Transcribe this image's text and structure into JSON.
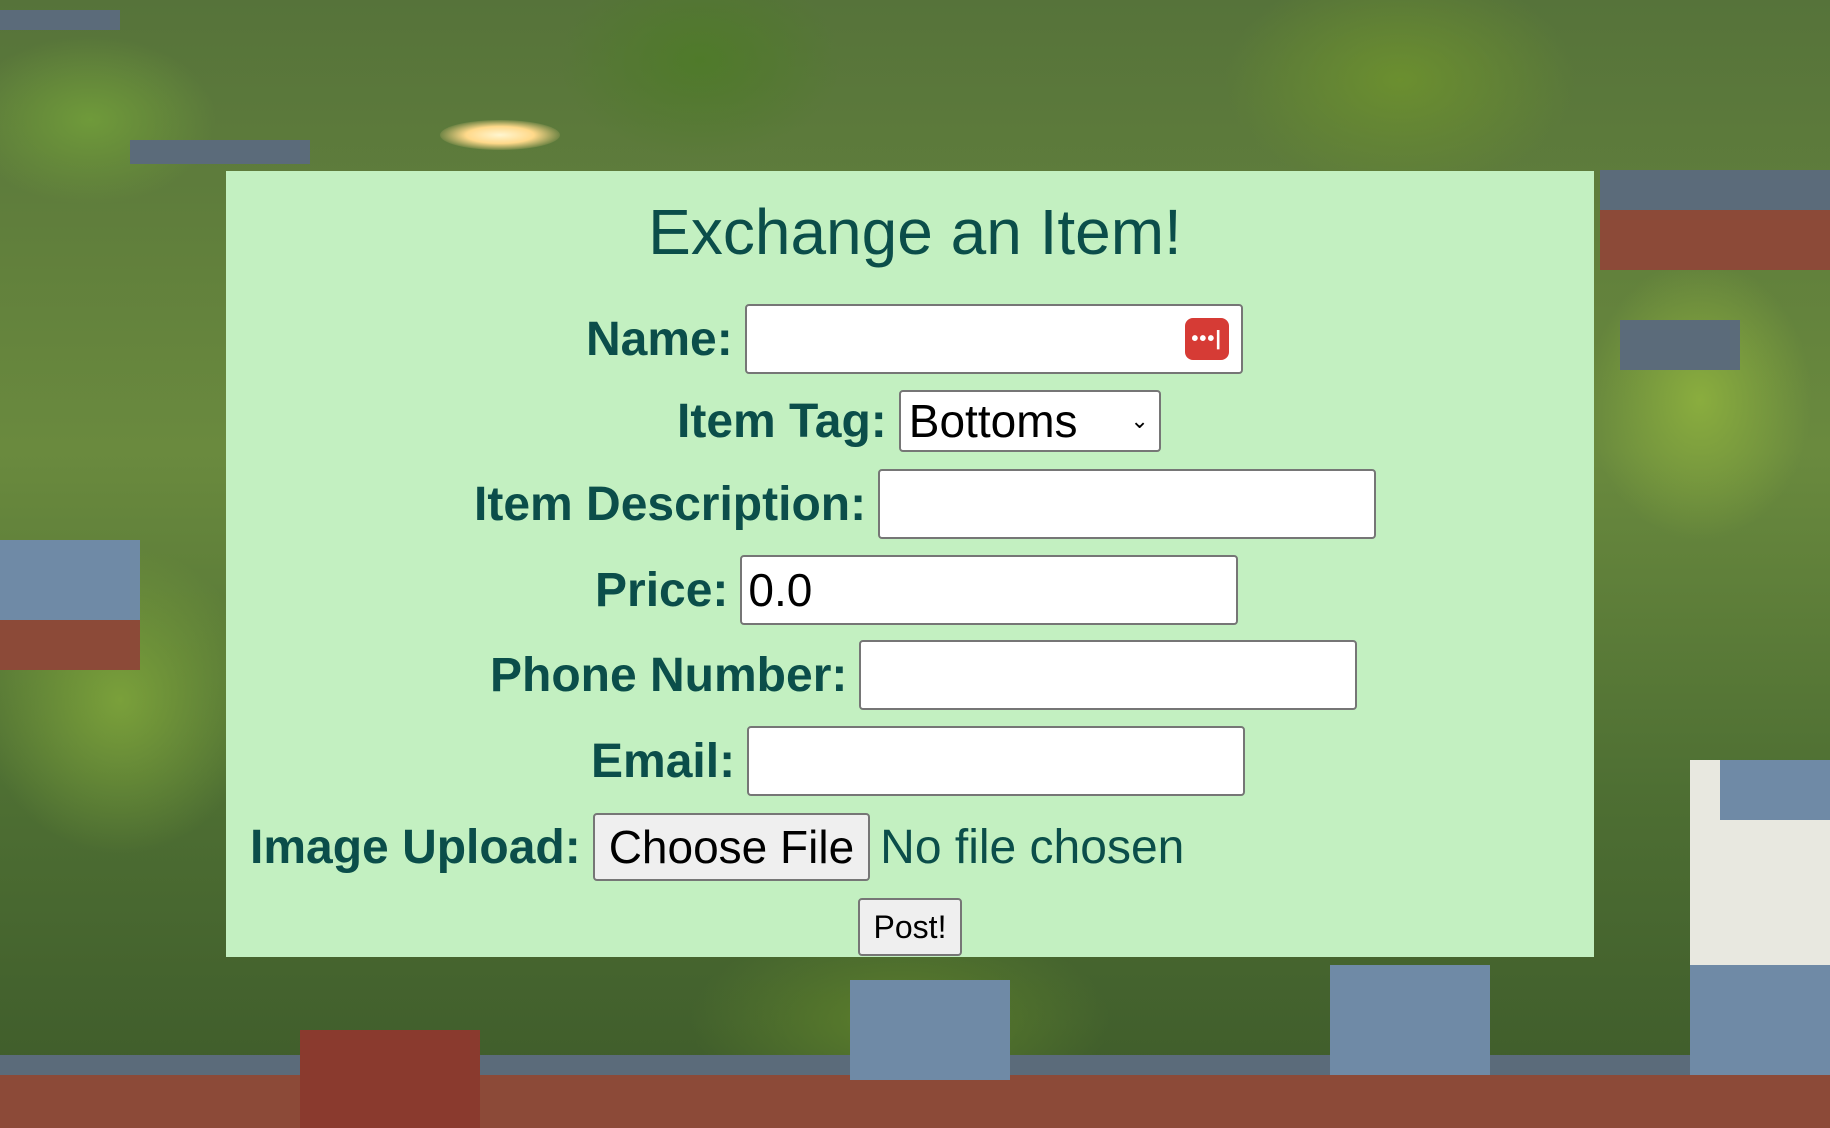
{
  "form": {
    "title": "Exchange an Item!",
    "name_label": "Name:",
    "name_value": "",
    "password_manager_icon": "•••|",
    "item_tag_label": "Item Tag:",
    "item_tag_selected": "Bottoms",
    "item_description_label": "Item Description:",
    "item_description_value": "",
    "price_label": "Price:",
    "price_value": "0.0",
    "phone_label": "Phone Number:",
    "phone_value": "",
    "email_label": "Email:",
    "email_value": "",
    "image_upload_label": "Image Upload:",
    "choose_file_label": "Choose File",
    "no_file_text": "No file chosen",
    "submit_label": "Post!"
  },
  "colors": {
    "panel_bg": "#c3f0c1",
    "text": "#0b4e4a",
    "password_icon_bg": "#d63b35"
  },
  "icons": [
    "password-manager-icon",
    "chevron-down-icon"
  ]
}
